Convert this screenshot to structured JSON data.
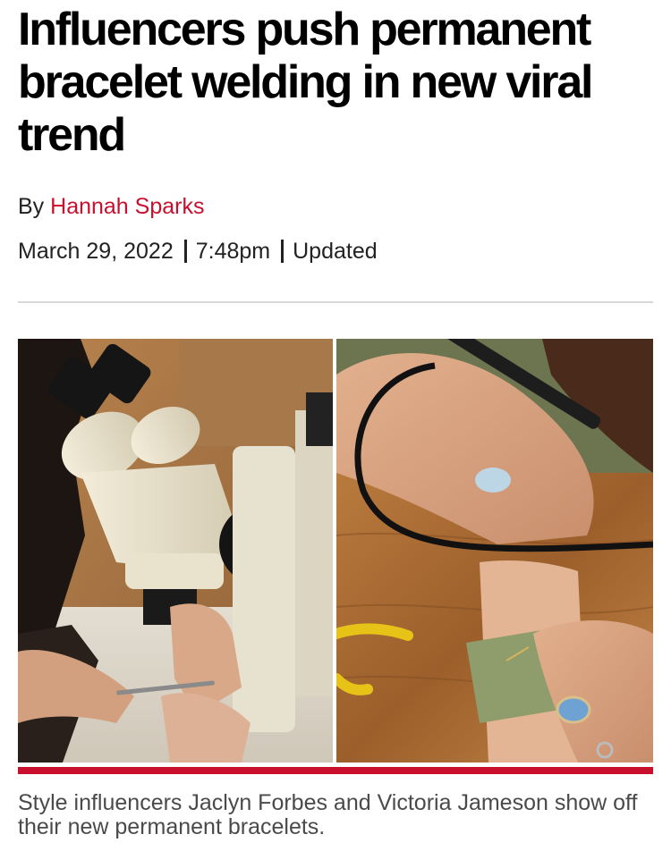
{
  "article": {
    "headline": "Influencers push permanent bracelet welding in new viral trend",
    "byline": {
      "prefix": "By",
      "author": "Hannah Sparks"
    },
    "date": "March 29, 2022",
    "time": "7:48pm",
    "updated_label": "Updated"
  },
  "photo": {
    "left_alt": "Microscope used to weld a bracelet on a wrist",
    "right_alt": "Welding pen applied to a bracelet on a wrist",
    "caption": "Style influencers Jaclyn Forbes and Victoria Jameson show off their new permanent bracelets."
  },
  "colors": {
    "accent": "#c8102e",
    "author_link": "#c8102e",
    "caption_text": "#4a4a4a"
  }
}
